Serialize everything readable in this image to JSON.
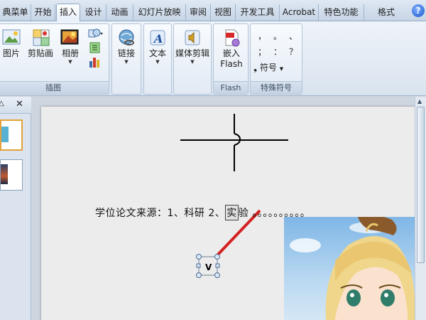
{
  "tabs": [
    {
      "label": "典菜单",
      "active": false
    },
    {
      "label": "开始",
      "active": false
    },
    {
      "label": "插入",
      "active": true
    },
    {
      "label": "设计",
      "active": false
    },
    {
      "label": "动画",
      "active": false
    },
    {
      "label": "幻灯片放映",
      "active": false
    },
    {
      "label": "审阅",
      "active": false
    },
    {
      "label": "视图",
      "active": false
    },
    {
      "label": "开发工具",
      "active": false
    },
    {
      "label": "Acrobat",
      "active": false
    },
    {
      "label": "特色功能",
      "active": false
    },
    {
      "label": "格式",
      "active": false
    }
  ],
  "help_glyph": "?",
  "ribbon": {
    "illustrations": {
      "picture_label": "图片",
      "clipart_label": "剪贴画",
      "album_label": "相册",
      "group_label": "插图"
    },
    "link": {
      "button_label": "链接"
    },
    "text": {
      "button_label": "文本"
    },
    "media": {
      "button_label": "媒体剪辑"
    },
    "flash": {
      "insert_label_line1": "嵌入",
      "insert_label_line2": "Flash",
      "group_label": "Flash"
    },
    "special_symbols": {
      "row1": [
        "，",
        "。",
        "、"
      ],
      "row2": [
        "；",
        "：",
        "？"
      ],
      "symbol_button_label": "符号",
      "group_label": "特殊符号"
    }
  },
  "pane": {
    "close_glyph": "✕"
  },
  "slide": {
    "text_before": "学位论文来源：1、科研   2、",
    "text_boxed": "实",
    "text_after": "验   。。。。。。。。。。",
    "shape_letter": "V"
  },
  "colors": {
    "connector": "#d42020",
    "active_tab": "#ffffff",
    "accent": "#1a55c8"
  }
}
